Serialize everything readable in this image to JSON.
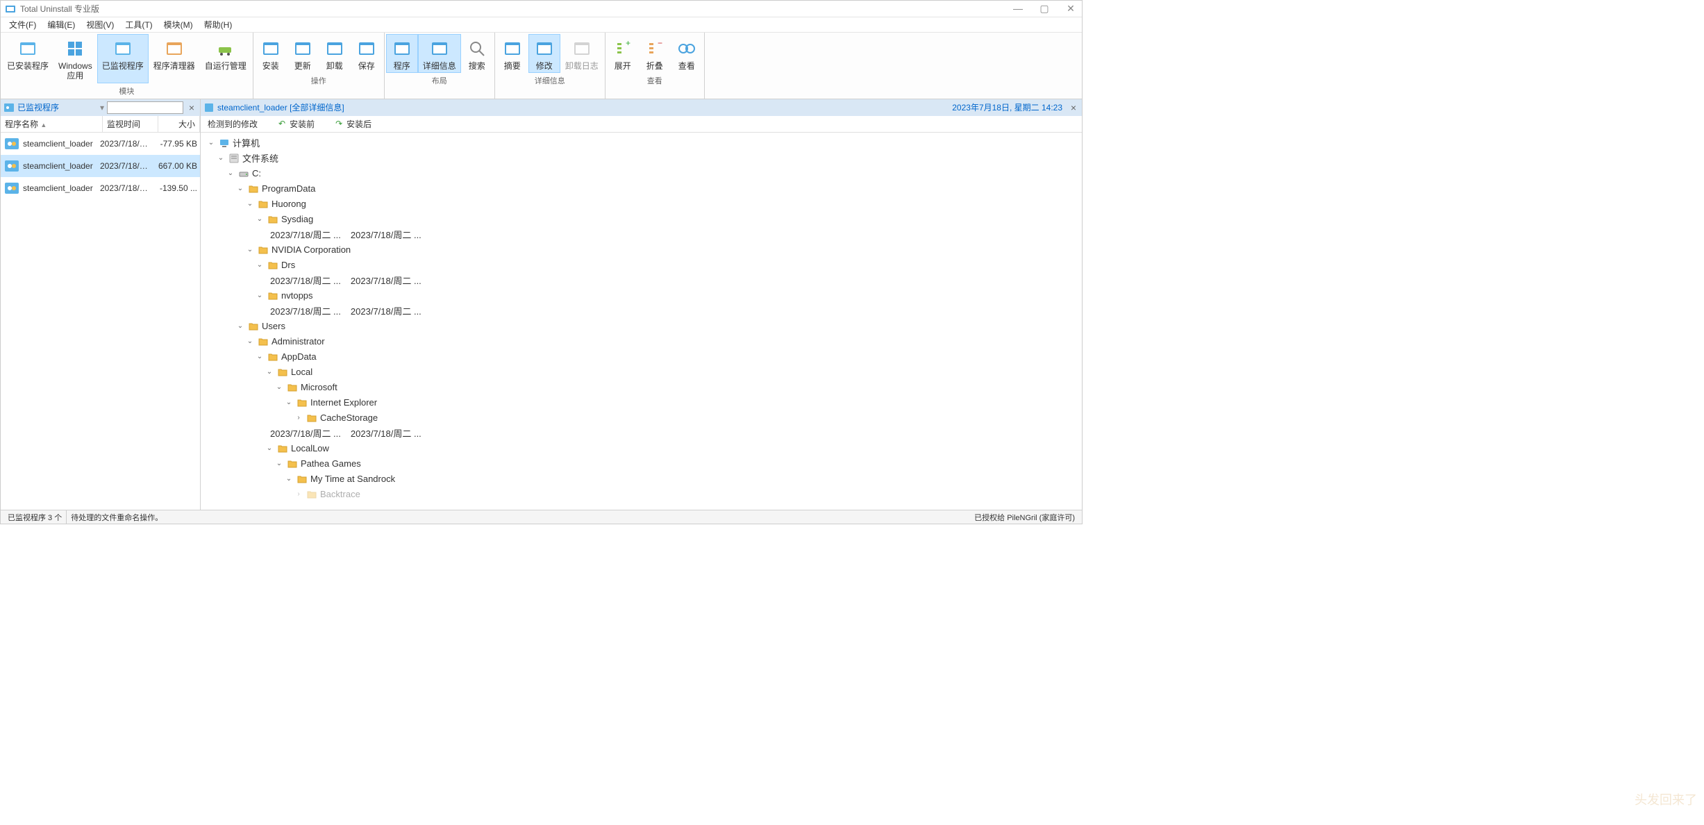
{
  "title": "Total Uninstall 专业版",
  "menu": [
    "文件(F)",
    "编辑(E)",
    "视图(V)",
    "工具(T)",
    "模块(M)",
    "帮助(H)"
  ],
  "ribbon": {
    "groups": [
      {
        "label": "模块",
        "buttons": [
          {
            "id": "installed",
            "label": "已安装程序"
          },
          {
            "id": "winapps",
            "label": "Windows\n应用"
          },
          {
            "id": "monitored",
            "label": "已监视程序",
            "active": true
          },
          {
            "id": "cleaner",
            "label": "程序清理器"
          },
          {
            "id": "autorun",
            "label": "自运行管理"
          }
        ]
      },
      {
        "label": "操作",
        "buttons": [
          {
            "id": "install",
            "label": "安装"
          },
          {
            "id": "update",
            "label": "更新"
          },
          {
            "id": "uninstall",
            "label": "卸载"
          },
          {
            "id": "save",
            "label": "保存"
          }
        ]
      },
      {
        "label": "布局",
        "buttons": [
          {
            "id": "program",
            "label": "程序",
            "active": true
          },
          {
            "id": "details",
            "label": "详细信息",
            "active": true
          },
          {
            "id": "search",
            "label": "搜索"
          }
        ]
      },
      {
        "label": "详细信息",
        "buttons": [
          {
            "id": "summary",
            "label": "摘要"
          },
          {
            "id": "modify",
            "label": "修改",
            "active": true
          },
          {
            "id": "uninstlog",
            "label": "卸载日志",
            "disabled": true
          }
        ]
      },
      {
        "label": "查看",
        "buttons": [
          {
            "id": "expand",
            "label": "展开"
          },
          {
            "id": "collapse",
            "label": "折叠"
          },
          {
            "id": "view",
            "label": "查看"
          }
        ]
      }
    ]
  },
  "leftPane": {
    "title": "已监视程序",
    "columns": {
      "name": "程序名称",
      "time": "监视时间",
      "size": "大小"
    },
    "items": [
      {
        "name": "steamclient_loader",
        "time": "2023/7/18/周二 ...",
        "size": "-77.95 KB"
      },
      {
        "name": "steamclient_loader",
        "time": "2023/7/18/周二 ...",
        "size": "667.00 KB",
        "selected": true
      },
      {
        "name": "steamclient_loader",
        "time": "2023/7/18/周二 ...",
        "size": "-139.50 ..."
      }
    ]
  },
  "rightPane": {
    "title": "steamclient_loader",
    "suffix": "[全部详细信息]",
    "datetime": "2023年7月18日, 星期二  14:23",
    "tabs": [
      {
        "id": "detected",
        "label": "检测到的修改"
      },
      {
        "id": "before",
        "label": "安装前",
        "arrow": "undo"
      },
      {
        "id": "after",
        "label": "安装后",
        "arrow": "redo"
      }
    ]
  },
  "tree": [
    {
      "d": 0,
      "icon": "computer",
      "label": "计算机",
      "open": true
    },
    {
      "d": 1,
      "icon": "fs",
      "label": "文件系统",
      "open": true
    },
    {
      "d": 2,
      "icon": "drive",
      "label": "C:",
      "open": true
    },
    {
      "d": 3,
      "icon": "folder",
      "label": "ProgramData",
      "open": true
    },
    {
      "d": 4,
      "icon": "folder",
      "label": "Huorong",
      "open": true
    },
    {
      "d": 5,
      "icon": "folder",
      "label": "Sysdiag",
      "open": true
    },
    {
      "d": 5,
      "dates": [
        "2023/7/18/周二 ...",
        "2023/7/18/周二 ..."
      ]
    },
    {
      "d": 4,
      "icon": "folder",
      "label": "NVIDIA Corporation",
      "open": true
    },
    {
      "d": 5,
      "icon": "folder",
      "label": "Drs",
      "open": true
    },
    {
      "d": 5,
      "dates": [
        "2023/7/18/周二 ...",
        "2023/7/18/周二 ..."
      ]
    },
    {
      "d": 5,
      "icon": "folder",
      "label": "nvtopps",
      "open": true
    },
    {
      "d": 5,
      "dates": [
        "2023/7/18/周二 ...",
        "2023/7/18/周二 ..."
      ]
    },
    {
      "d": 3,
      "icon": "folder",
      "label": "Users",
      "open": true
    },
    {
      "d": 4,
      "icon": "folder",
      "label": "Administrator",
      "open": true
    },
    {
      "d": 5,
      "icon": "folder",
      "label": "AppData",
      "open": true
    },
    {
      "d": 6,
      "icon": "folder",
      "label": "Local",
      "open": true
    },
    {
      "d": 7,
      "icon": "folder",
      "label": "Microsoft",
      "open": true
    },
    {
      "d": 8,
      "icon": "folder",
      "label": "Internet Explorer",
      "open": true
    },
    {
      "d": 9,
      "icon": "folder",
      "label": "CacheStorage",
      "open": false
    },
    {
      "d": 5,
      "dates": [
        "2023/7/18/周二 ...",
        "2023/7/18/周二 ..."
      ]
    },
    {
      "d": 6,
      "icon": "folder",
      "label": "LocalLow",
      "open": true
    },
    {
      "d": 7,
      "icon": "folder",
      "label": "Pathea Games",
      "open": true
    },
    {
      "d": 8,
      "icon": "folder",
      "label": "My Time at Sandrock",
      "open": true
    },
    {
      "d": 9,
      "icon": "folder",
      "label": "Backtrace",
      "open": false,
      "cut": true
    }
  ],
  "status": {
    "left1": "已监视程序 3 个",
    "left2": "待处理的文件重命名操作。",
    "right": "已授权给  PileNGril  (家庭许可)"
  },
  "watermark": "头发回来了"
}
